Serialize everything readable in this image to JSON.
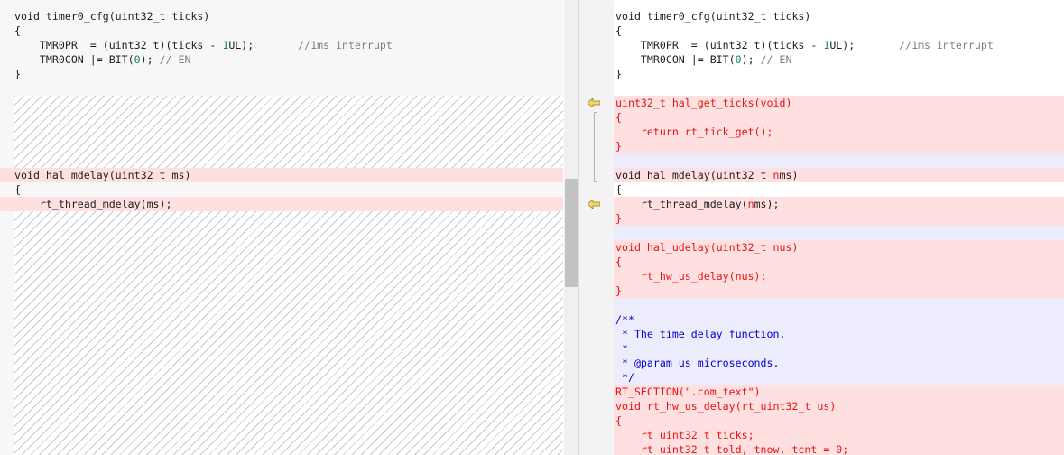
{
  "left_pane": {
    "lines": [
      {
        "segments": [
          {
            "t": "void timer0_cfg(uint32_t ticks)",
            "c": "t-plain"
          }
        ]
      },
      {
        "segments": [
          {
            "t": "{",
            "c": "t-plain"
          }
        ]
      },
      {
        "segments": [
          {
            "t": "    TMR0PR  = (uint32_t)(ticks - ",
            "c": "t-plain"
          },
          {
            "t": "1",
            "c": "t-num"
          },
          {
            "t": "UL);       ",
            "c": "t-plain"
          },
          {
            "t": "//1ms interrupt",
            "c": "t-cmt"
          }
        ]
      },
      {
        "segments": [
          {
            "t": "    TMR0CON |= BIT(",
            "c": "t-plain"
          },
          {
            "t": "0",
            "c": "t-num"
          },
          {
            "t": "); ",
            "c": "t-plain"
          },
          {
            "t": "// EN",
            "c": "t-cmt"
          }
        ]
      },
      {
        "segments": [
          {
            "t": "}",
            "c": "t-plain"
          }
        ]
      },
      {
        "segments": [
          {
            "t": "void hal_mdelay(uint32_t ms)",
            "c": "t-plain"
          }
        ]
      },
      {
        "segments": [
          {
            "t": "{",
            "c": "t-plain"
          }
        ]
      },
      {
        "segments": [
          {
            "t": "    rt_thread_mdelay(ms);",
            "c": "t-plain"
          }
        ]
      }
    ]
  },
  "right_pane": {
    "lines": [
      {
        "segments": [
          {
            "t": "void timer0_cfg(uint32_t ticks)",
            "c": "t-plain"
          }
        ]
      },
      {
        "segments": [
          {
            "t": "{",
            "c": "t-plain"
          }
        ]
      },
      {
        "segments": [
          {
            "t": "    TMR0PR  = (uint32_t)(ticks - ",
            "c": "t-plain"
          },
          {
            "t": "1",
            "c": "t-num"
          },
          {
            "t": "UL);       ",
            "c": "t-plain"
          },
          {
            "t": "//1ms interrupt",
            "c": "t-cmt"
          }
        ]
      },
      {
        "segments": [
          {
            "t": "    TMR0CON |= BIT(",
            "c": "t-plain"
          },
          {
            "t": "0",
            "c": "t-num"
          },
          {
            "t": "); ",
            "c": "t-plain"
          },
          {
            "t": "// EN",
            "c": "t-cmt"
          }
        ]
      },
      {
        "segments": [
          {
            "t": "}",
            "c": "t-plain"
          }
        ]
      },
      {
        "segments": [
          {
            "t": "uint32_t hal_get_ticks(void)",
            "c": "t-red"
          }
        ]
      },
      {
        "segments": [
          {
            "t": "{",
            "c": "t-red"
          }
        ]
      },
      {
        "segments": [
          {
            "t": "    return rt_tick_get();",
            "c": "t-red"
          }
        ]
      },
      {
        "segments": [
          {
            "t": "}",
            "c": "t-red"
          }
        ]
      },
      {
        "segments": [
          {
            "t": "void hal_mdelay(uint32_t ",
            "c": "t-plain"
          },
          {
            "t": "n",
            "c": "t-red"
          },
          {
            "t": "ms)",
            "c": "t-plain"
          }
        ]
      },
      {
        "segments": [
          {
            "t": "{",
            "c": "t-plain"
          }
        ]
      },
      {
        "segments": [
          {
            "t": "    rt_thread_mdelay(",
            "c": "t-plain"
          },
          {
            "t": "n",
            "c": "t-red"
          },
          {
            "t": "ms);",
            "c": "t-plain"
          }
        ]
      },
      {
        "segments": [
          {
            "t": "}",
            "c": "t-red"
          }
        ]
      },
      {
        "segments": [
          {
            "t": "void hal_udelay(uint32_t nus)",
            "c": "t-red"
          }
        ]
      },
      {
        "segments": [
          {
            "t": "{",
            "c": "t-red"
          }
        ]
      },
      {
        "segments": [
          {
            "t": "    rt_hw_us_delay(nus);",
            "c": "t-red"
          }
        ]
      },
      {
        "segments": [
          {
            "t": "}",
            "c": "t-red"
          }
        ]
      },
      {
        "segments": [
          {
            "t": "/**",
            "c": "t-blue"
          }
        ]
      },
      {
        "segments": [
          {
            "t": " * The time delay function.",
            "c": "t-blue"
          }
        ]
      },
      {
        "segments": [
          {
            "t": " *",
            "c": "t-blue"
          }
        ]
      },
      {
        "segments": [
          {
            "t": " * @param us microseconds.",
            "c": "t-blue"
          }
        ]
      },
      {
        "segments": [
          {
            "t": " */",
            "c": "t-blue"
          }
        ]
      },
      {
        "segments": [
          {
            "t": "RT_SECTION(\".com_text\")",
            "c": "t-red"
          }
        ]
      },
      {
        "segments": [
          {
            "t": "void rt_hw_us_delay(rt_uint32_t us)",
            "c": "t-red"
          }
        ]
      },
      {
        "segments": [
          {
            "t": "{",
            "c": "t-red"
          }
        ]
      },
      {
        "segments": [
          {
            "t": "    rt_uint32_t ticks;",
            "c": "t-red"
          }
        ]
      },
      {
        "segments": [
          {
            "t": "    rt_uint32_t told, tnow, tcnt = 0;",
            "c": "t-red"
          }
        ]
      }
    ]
  },
  "icons": {
    "change_arrow_1": "arrow-left-icon",
    "change_arrow_2": "arrow-left-icon"
  },
  "colors": {
    "removed_bg": "#ffe0e0",
    "changed_bg": "#ececfc",
    "unchanged_bg": "#f7f7f7",
    "added_text": "#e51414",
    "comment_text": "#0000c8",
    "arrow_fill": "#f5d66b"
  }
}
